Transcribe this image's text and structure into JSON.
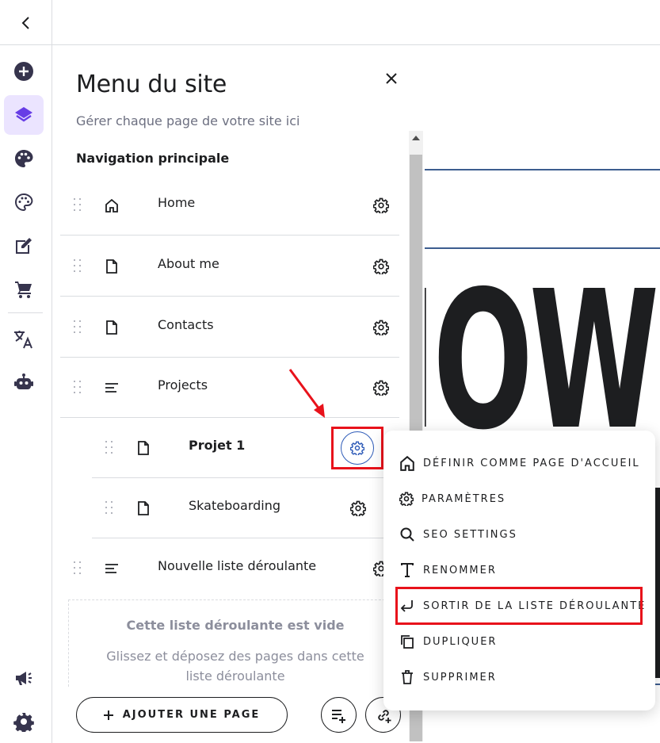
{
  "panel": {
    "title": "Menu du site",
    "subtitle": "Gérer chaque page de votre site ici",
    "nav_heading": "Navigation principale",
    "pages": [
      {
        "label": "Home",
        "icon": "home-icon"
      },
      {
        "label": "About me",
        "icon": "page-icon"
      },
      {
        "label": "Contacts",
        "icon": "page-icon"
      },
      {
        "label": "Projects",
        "icon": "dropdown-list-icon"
      },
      {
        "label": "Projet 1",
        "icon": "page-icon",
        "nested": true,
        "selected": true
      },
      {
        "label": "Skateboarding",
        "icon": "page-icon",
        "nested": true
      },
      {
        "label": "Nouvelle liste déroulante",
        "icon": "dropdown-list-icon"
      }
    ],
    "empty_title": "Cette liste déroulante est vide",
    "empty_desc": "Glissez et déposez des pages dans cette liste déroulante",
    "add_page_label": "AJOUTER UNE PAGE"
  },
  "context_menu": {
    "items": [
      {
        "label": "DÉFINIR COMME PAGE D'ACCUEIL",
        "icon": "home-icon"
      },
      {
        "label": "PARAMÈTRES",
        "icon": "gear-icon"
      },
      {
        "label": "SEO SETTINGS",
        "icon": "search-icon"
      },
      {
        "label": "RENOMMER",
        "icon": "text-icon"
      },
      {
        "label": "SORTIR DE LA LISTE DÉROULANTE",
        "icon": "return-arrow-icon",
        "highlighted": true
      },
      {
        "label": "DUPLIQUER",
        "icon": "duplicate-icon"
      },
      {
        "label": "SUPPRIMER",
        "icon": "trash-icon"
      }
    ]
  },
  "canvas": {
    "headline_fragment": "IOW"
  },
  "colors": {
    "accent": "#673de6",
    "active_bg": "#ebe4ff",
    "highlight_red": "#e8121b",
    "selected_gear_blue": "#2e5bb8"
  }
}
